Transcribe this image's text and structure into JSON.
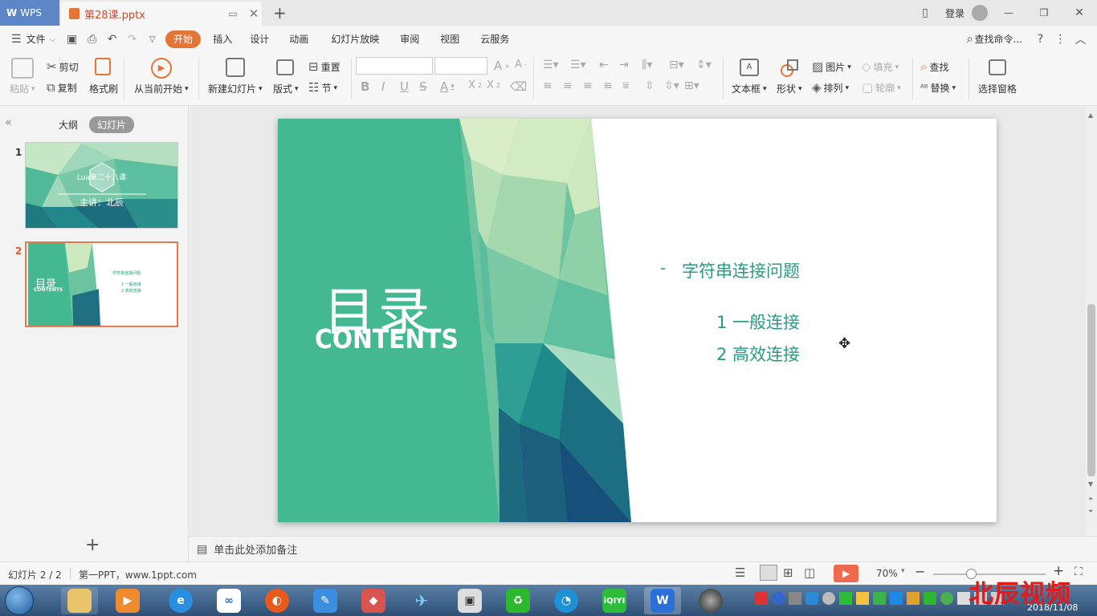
{
  "titlebar": {
    "app_tab": "WPS",
    "doc_tab": "第28课.pptx",
    "login": "登录"
  },
  "menu": {
    "file": "文件",
    "tabs": [
      "开始",
      "插入",
      "设计",
      "动画",
      "幻灯片放映",
      "审阅",
      "视图",
      "云服务"
    ],
    "search": "查找命令..."
  },
  "ribbon": {
    "paste": "粘贴",
    "cut": "剪切",
    "copy": "复制",
    "format_painter": "格式刷",
    "start_from_current": "从当前开始",
    "new_slide": "新建幻灯片",
    "layout": "版式",
    "reset": "重置",
    "section": "节",
    "text_box": "文本框",
    "shape": "形状",
    "picture": "图片",
    "arrange": "排列",
    "fill": "填充",
    "outline": "轮廓",
    "find": "查找",
    "replace": "替换",
    "selection_pane": "选择窗格"
  },
  "left_panel": {
    "tab_outline": "大纲",
    "tab_slides": "幻灯片",
    "thumb1_num": "1",
    "thumb1_title": "Lua第二十八课",
    "thumb1_sub": "主讲：北辰",
    "thumb2_num": "2",
    "thumb2_title": "目录",
    "thumb2_sub": "CONTENTS"
  },
  "slide": {
    "title": "目录",
    "subtitle": "CONTENTS",
    "bullet_marker": "-",
    "bullet": "字符串连接问题",
    "item1": "1 一般连接",
    "item2": "2 高效连接"
  },
  "notes": {
    "placeholder": "单击此处添加备注"
  },
  "status": {
    "slide_counter": "幻灯片 2 / 2",
    "template": "第一PPT，www.1ppt.com",
    "zoom": "70%"
  },
  "taskbar": {
    "clock_date": "2018/11/08",
    "watermark": "北辰视频"
  },
  "colors": {
    "accent_orange": "#e57437",
    "slide_green": "#44b991",
    "text_teal": "#2a9a83",
    "wps_blue": "#5d86c8"
  }
}
